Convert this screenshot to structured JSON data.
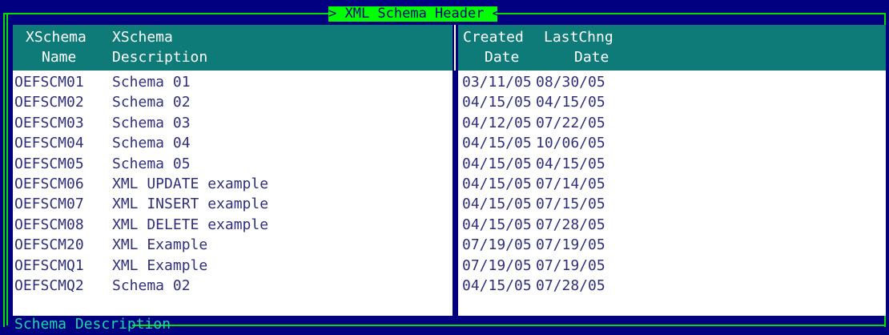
{
  "window": {
    "title": "> XML Schema Header <"
  },
  "columns": {
    "name": {
      "line1": "XSchema",
      "line2": "Name"
    },
    "description": {
      "line1": "XSchema",
      "line2": "Description"
    },
    "created": {
      "line1": "Created",
      "line2": "Date"
    },
    "changed": {
      "line1": "LastChng",
      "line2": "Date"
    }
  },
  "rows": [
    {
      "name": "OEFSCM01",
      "description": "Schema 01",
      "created": "03/11/05",
      "changed": "08/30/05"
    },
    {
      "name": "OEFSCM02",
      "description": "Schema 02",
      "created": "04/15/05",
      "changed": "04/15/05"
    },
    {
      "name": "OEFSCM03",
      "description": "Schema 03",
      "created": "04/12/05",
      "changed": "07/22/05"
    },
    {
      "name": "OEFSCM04",
      "description": "Schema 04",
      "created": "04/15/05",
      "changed": "10/06/05"
    },
    {
      "name": "OEFSCM05",
      "description": "Schema 05",
      "created": "04/15/05",
      "changed": "04/15/05"
    },
    {
      "name": "OEFSCM06",
      "description": "XML UPDATE example",
      "created": "04/15/05",
      "changed": "07/14/05"
    },
    {
      "name": "OEFSCM07",
      "description": "XML INSERT example",
      "created": "04/15/05",
      "changed": "07/15/05"
    },
    {
      "name": "OEFSCM08",
      "description": "XML DELETE example",
      "created": "04/15/05",
      "changed": "07/28/05"
    },
    {
      "name": "OEFSCM20",
      "description": "XML Example",
      "created": "07/19/05",
      "changed": "07/19/05"
    },
    {
      "name": "OEFSCMQ1",
      "description": "XML Example",
      "created": "07/19/05",
      "changed": "07/19/05"
    },
    {
      "name": "OEFSCMQ2",
      "description": "Schema 02",
      "created": "04/15/05",
      "changed": "07/28/05"
    }
  ],
  "footer": {
    "label": "Schema Description"
  },
  "colors": {
    "background": "#000080",
    "frame": "#00e000",
    "title_bg": "#00ff00",
    "header_bg": "#0f7b78",
    "row_text": "#30307a",
    "footer_text": "#1fd6a6"
  }
}
